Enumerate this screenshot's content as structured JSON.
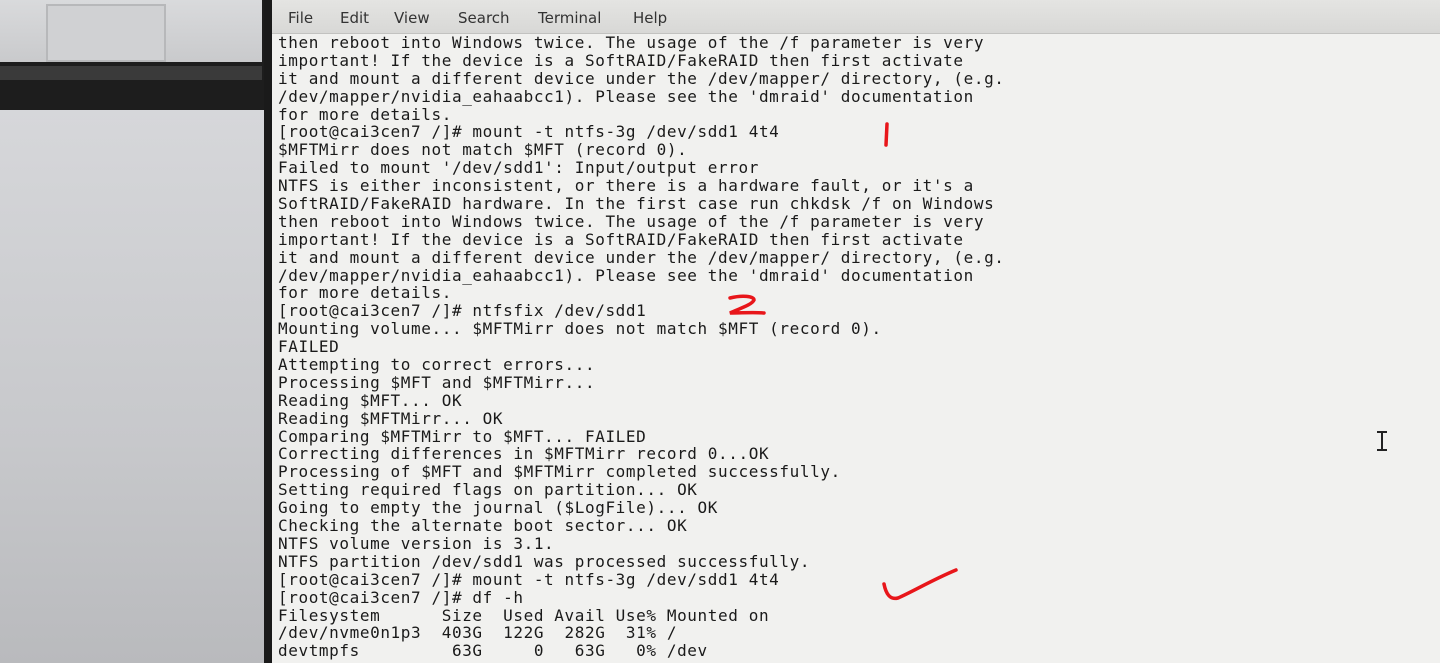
{
  "menu": [
    "File",
    "Edit",
    "View",
    "Search",
    "Terminal",
    "Help"
  ],
  "terminal_lines": [
    "then reboot into Windows twice. The usage of the /f parameter is very",
    "important! If the device is a SoftRAID/FakeRAID then first activate",
    "it and mount a different device under the /dev/mapper/ directory, (e.g.",
    "/dev/mapper/nvidia_eahaabcc1). Please see the 'dmraid' documentation",
    "for more details.",
    "[root@cai3cen7 /]# mount -t ntfs-3g /dev/sdd1 4t4",
    "$MFTMirr does not match $MFT (record 0).",
    "Failed to mount '/dev/sdd1': Input/output error",
    "NTFS is either inconsistent, or there is a hardware fault, or it's a",
    "SoftRAID/FakeRAID hardware. In the first case run chkdsk /f on Windows",
    "then reboot into Windows twice. The usage of the /f parameter is very",
    "important! If the device is a SoftRAID/FakeRAID then first activate",
    "it and mount a different device under the /dev/mapper/ directory, (e.g.",
    "/dev/mapper/nvidia_eahaabcc1). Please see the 'dmraid' documentation",
    "for more details.",
    "[root@cai3cen7 /]# ntfsfix /dev/sdd1",
    "Mounting volume... $MFTMirr does not match $MFT (record 0).",
    "FAILED",
    "Attempting to correct errors...",
    "Processing $MFT and $MFTMirr...",
    "Reading $MFT... OK",
    "Reading $MFTMirr... OK",
    "Comparing $MFTMirr to $MFT... FAILED",
    "Correcting differences in $MFTMirr record 0...OK",
    "Processing of $MFT and $MFTMirr completed successfully.",
    "Setting required flags on partition... OK",
    "Going to empty the journal ($LogFile)... OK",
    "Checking the alternate boot sector... OK",
    "NTFS volume version is 3.1.",
    "NTFS partition /dev/sdd1 was processed successfully.",
    "[root@cai3cen7 /]# mount -t ntfs-3g /dev/sdd1 4t4",
    "[root@cai3cen7 /]# df -h",
    "Filesystem      Size  Used Avail Use% Mounted on",
    "/dev/nvme0n1p3  403G  122G  282G  31% /",
    "devtmpfs         63G     0   63G   0% /dev"
  ],
  "annotations": {
    "mark1": "|",
    "mark2": "2",
    "checkmark": "check-mark"
  },
  "colors": {
    "terminal_bg": "#f1f1ef",
    "terminal_text": "#1a1a1a",
    "annotation_ink": "#e8161a"
  }
}
